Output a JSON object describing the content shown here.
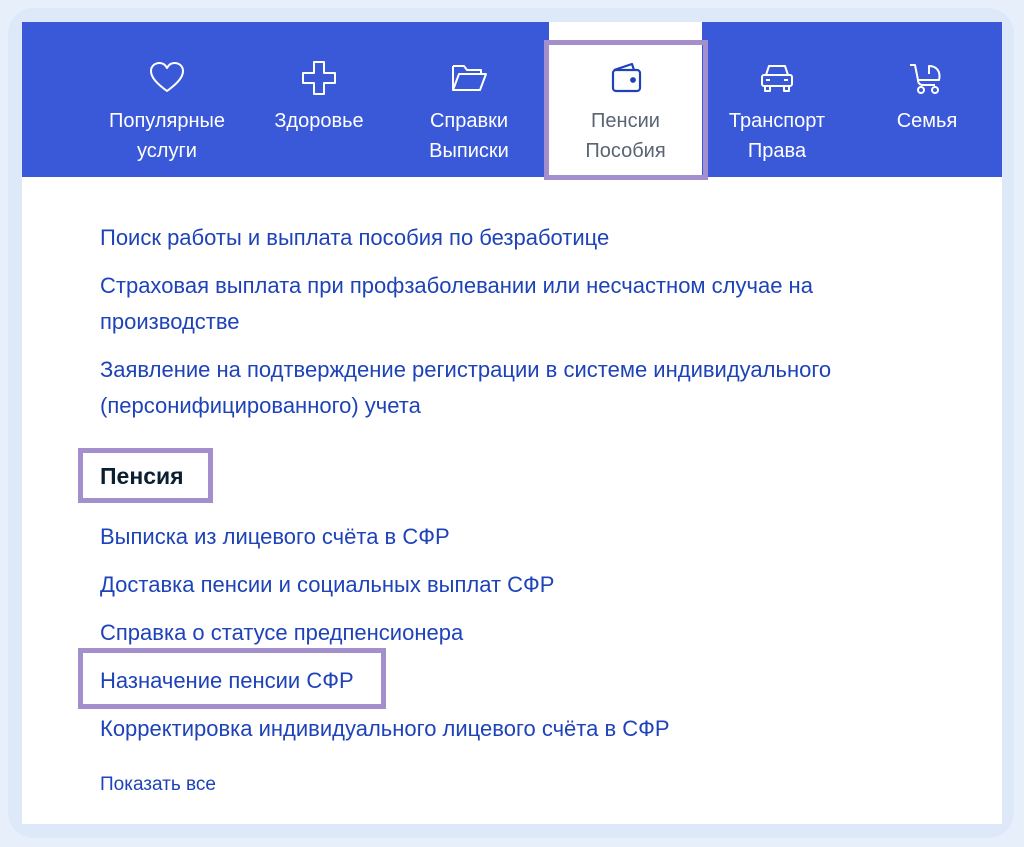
{
  "nav": {
    "tabs": [
      {
        "line1": "Популярные",
        "line2": "услуги",
        "icon": "heart-icon"
      },
      {
        "line1": "Здоровье",
        "line2": "",
        "icon": "medical-cross-icon"
      },
      {
        "line1": "Справки",
        "line2": "Выписки",
        "icon": "folder-icon"
      },
      {
        "line1": "Пенсии",
        "line2": "Пособия",
        "icon": "wallet-icon",
        "active": true
      },
      {
        "line1": "Транспорт",
        "line2": "Права",
        "icon": "car-icon"
      },
      {
        "line1": "Семья",
        "line2": "",
        "icon": "stroller-icon"
      }
    ]
  },
  "links_top": [
    {
      "lines": [
        "Поиск работы и выплата пособия по безработице"
      ]
    },
    {
      "lines": [
        "Страховая выплата при профзаболевании или несчастном случае на",
        "производстве"
      ]
    },
    {
      "lines": [
        "Заявление на подтверждение регистрации в системе индивидуального",
        "(персонифицированного) учета"
      ]
    }
  ],
  "section": {
    "title": "Пенсия"
  },
  "links_pension": [
    "Выписка из лицевого счёта в СФР",
    "Доставка пенсии и социальных выплат СФР",
    "Справка о статусе предпенсионера",
    "Назначение пенсии СФР",
    "Корректировка индивидуального лицевого счёта в СФР"
  ],
  "show_all": "Показать все",
  "colors": {
    "nav_background": "#3a59d9",
    "link": "#1e43b8",
    "highlight_border": "#a28fcb",
    "heading": "#0b1f33"
  }
}
